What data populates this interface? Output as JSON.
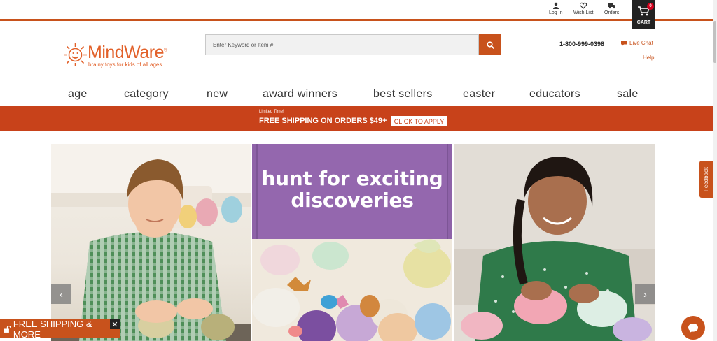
{
  "utility": {
    "login": "Log In",
    "wishlist": "Wish List",
    "orders": "Orders",
    "cart_label": "CART",
    "cart_count": "0"
  },
  "logo": {
    "word": "MindWare",
    "registered": "®",
    "tagline": "brainy toys for kids of all ages"
  },
  "search": {
    "placeholder": "Enter Keyword or Item #"
  },
  "contact": {
    "phone": "1-800-999-0398",
    "live_chat": "Live Chat",
    "help": "Help"
  },
  "nav": {
    "items": [
      "age",
      "category",
      "new",
      "award winners",
      "best sellers",
      "easter",
      "educators",
      "sale"
    ]
  },
  "promo": {
    "small": "Limited Time!",
    "big": "FREE SHIPPING ON ORDERS $49+",
    "button": "CLICK TO APPLY"
  },
  "hero": {
    "line1": "hunt for exciting",
    "line2": "discoveries"
  },
  "carousel": {
    "prev": "‹",
    "next": "›"
  },
  "feedback": "Feedback",
  "freeship": {
    "label": "FREE SHIPPING & MORE",
    "close": "✕"
  },
  "colors": {
    "brand_orange": "#c8521c",
    "promo_red": "#c8421a",
    "purple": "#9467ae"
  }
}
